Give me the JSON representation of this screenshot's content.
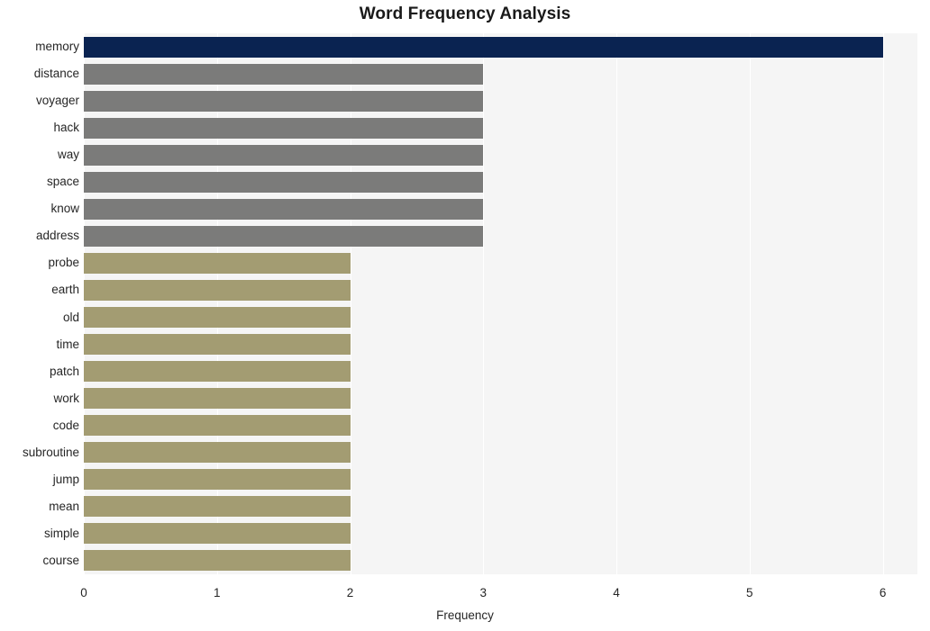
{
  "chart_data": {
    "type": "bar",
    "orientation": "horizontal",
    "title": "Word Frequency Analysis",
    "xlabel": "Frequency",
    "ylabel": "",
    "xlim": [
      0,
      6.26
    ],
    "xticks": [
      0,
      1,
      2,
      3,
      4,
      5,
      6
    ],
    "xtick_labels": [
      "0",
      "1",
      "2",
      "3",
      "4",
      "5",
      "6"
    ],
    "grid": "vertical",
    "legend": "none",
    "categories": [
      "memory",
      "distance",
      "voyager",
      "hack",
      "way",
      "space",
      "know",
      "address",
      "probe",
      "earth",
      "old",
      "time",
      "patch",
      "work",
      "code",
      "subroutine",
      "jump",
      "mean",
      "simple",
      "course"
    ],
    "values": [
      6,
      3,
      3,
      3,
      3,
      3,
      3,
      3,
      2,
      2,
      2,
      2,
      2,
      2,
      2,
      2,
      2,
      2,
      2,
      2
    ],
    "bar_colors": [
      "#0a2351",
      "#7b7b7a",
      "#7b7b7a",
      "#7b7b7a",
      "#7b7b7a",
      "#7b7b7a",
      "#7b7b7a",
      "#7b7b7a",
      "#a39c72",
      "#a39c72",
      "#a39c72",
      "#a39c72",
      "#a39c72",
      "#a39c72",
      "#a39c72",
      "#a39c72",
      "#a39c72",
      "#a39c72",
      "#a39c72",
      "#a39c72"
    ],
    "palette": {
      "highest": "#0a2351",
      "mid": "#7b7b7a",
      "low": "#a39c72",
      "plot_background": "#f5f5f5",
      "gridline": "#ffffff",
      "text": "#262626",
      "title": "#1a1a1a"
    },
    "bars": [
      {
        "label": "memory",
        "value": 6,
        "color": "#0a2351"
      },
      {
        "label": "distance",
        "value": 3,
        "color": "#7b7b7a"
      },
      {
        "label": "voyager",
        "value": 3,
        "color": "#7b7b7a"
      },
      {
        "label": "hack",
        "value": 3,
        "color": "#7b7b7a"
      },
      {
        "label": "way",
        "value": 3,
        "color": "#7b7b7a"
      },
      {
        "label": "space",
        "value": 3,
        "color": "#7b7b7a"
      },
      {
        "label": "know",
        "value": 3,
        "color": "#7b7b7a"
      },
      {
        "label": "address",
        "value": 3,
        "color": "#7b7b7a"
      },
      {
        "label": "probe",
        "value": 2,
        "color": "#a39c72"
      },
      {
        "label": "earth",
        "value": 2,
        "color": "#a39c72"
      },
      {
        "label": "old",
        "value": 2,
        "color": "#a39c72"
      },
      {
        "label": "time",
        "value": 2,
        "color": "#a39c72"
      },
      {
        "label": "patch",
        "value": 2,
        "color": "#a39c72"
      },
      {
        "label": "work",
        "value": 2,
        "color": "#a39c72"
      },
      {
        "label": "code",
        "value": 2,
        "color": "#a39c72"
      },
      {
        "label": "subroutine",
        "value": 2,
        "color": "#a39c72"
      },
      {
        "label": "jump",
        "value": 2,
        "color": "#a39c72"
      },
      {
        "label": "mean",
        "value": 2,
        "color": "#a39c72"
      },
      {
        "label": "simple",
        "value": 2,
        "color": "#a39c72"
      },
      {
        "label": "course",
        "value": 2,
        "color": "#a39c72"
      }
    ]
  }
}
